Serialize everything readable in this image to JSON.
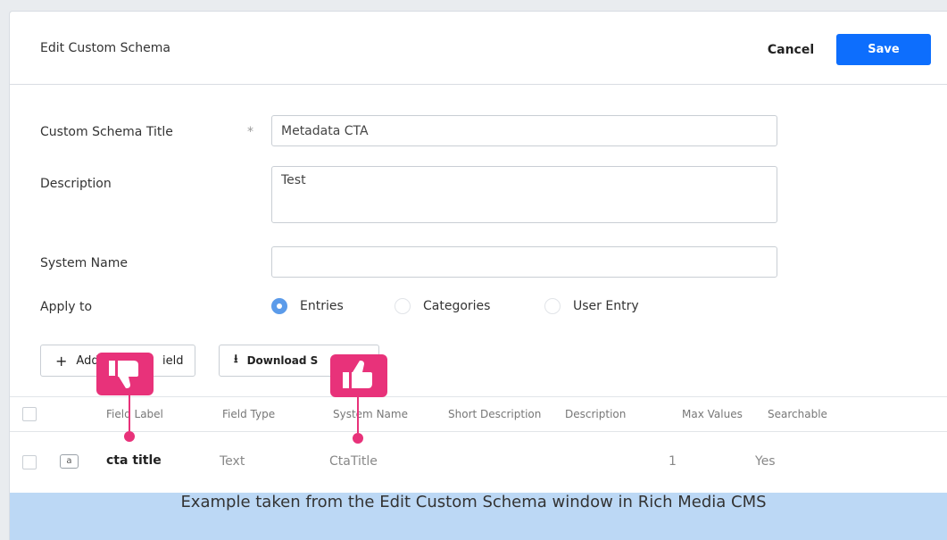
{
  "header": {
    "title": "Edit Custom Schema",
    "cancel_label": "Cancel",
    "save_label": "Save"
  },
  "form": {
    "title_label": "Custom Schema Title",
    "required_mark": "*",
    "title_value": "Metadata CTA",
    "description_label": "Description",
    "description_value": "Test",
    "system_name_label": "System Name",
    "system_name_value": "",
    "apply_to_label": "Apply to",
    "apply_options": [
      {
        "label": "Entries",
        "selected": true
      },
      {
        "label": "Categories",
        "selected": false
      },
      {
        "label": "User Entry",
        "selected": false
      }
    ]
  },
  "toolbar": {
    "add_field_label": "Add Field",
    "add_field_visible_left": "Add",
    "add_field_visible_right": "ield",
    "download_label": "Download S",
    "download_visible": "Download S"
  },
  "table": {
    "columns": [
      "Field Label",
      "Field Type",
      "System Name",
      "Short Description",
      "Description",
      "Max Values",
      "Searchable"
    ],
    "rows": [
      {
        "icon": "a",
        "field_label": "cta title",
        "field_type": "Text",
        "system_name": "CtaTitle",
        "short_description": "",
        "description": "",
        "max_values": "1",
        "searchable": "Yes"
      }
    ]
  },
  "annotations": {
    "thumbs_down_icon": "thumbs-down-icon",
    "thumbs_up_icon": "thumbs-up-icon",
    "color": "#e8327a"
  },
  "caption": "Example taken from the Edit Custom Schema window in Rich Media CMS",
  "colors": {
    "primary": "#0d6efd",
    "radio_selected": "#5b9bea",
    "caption_bg": "#bcd8f5"
  }
}
